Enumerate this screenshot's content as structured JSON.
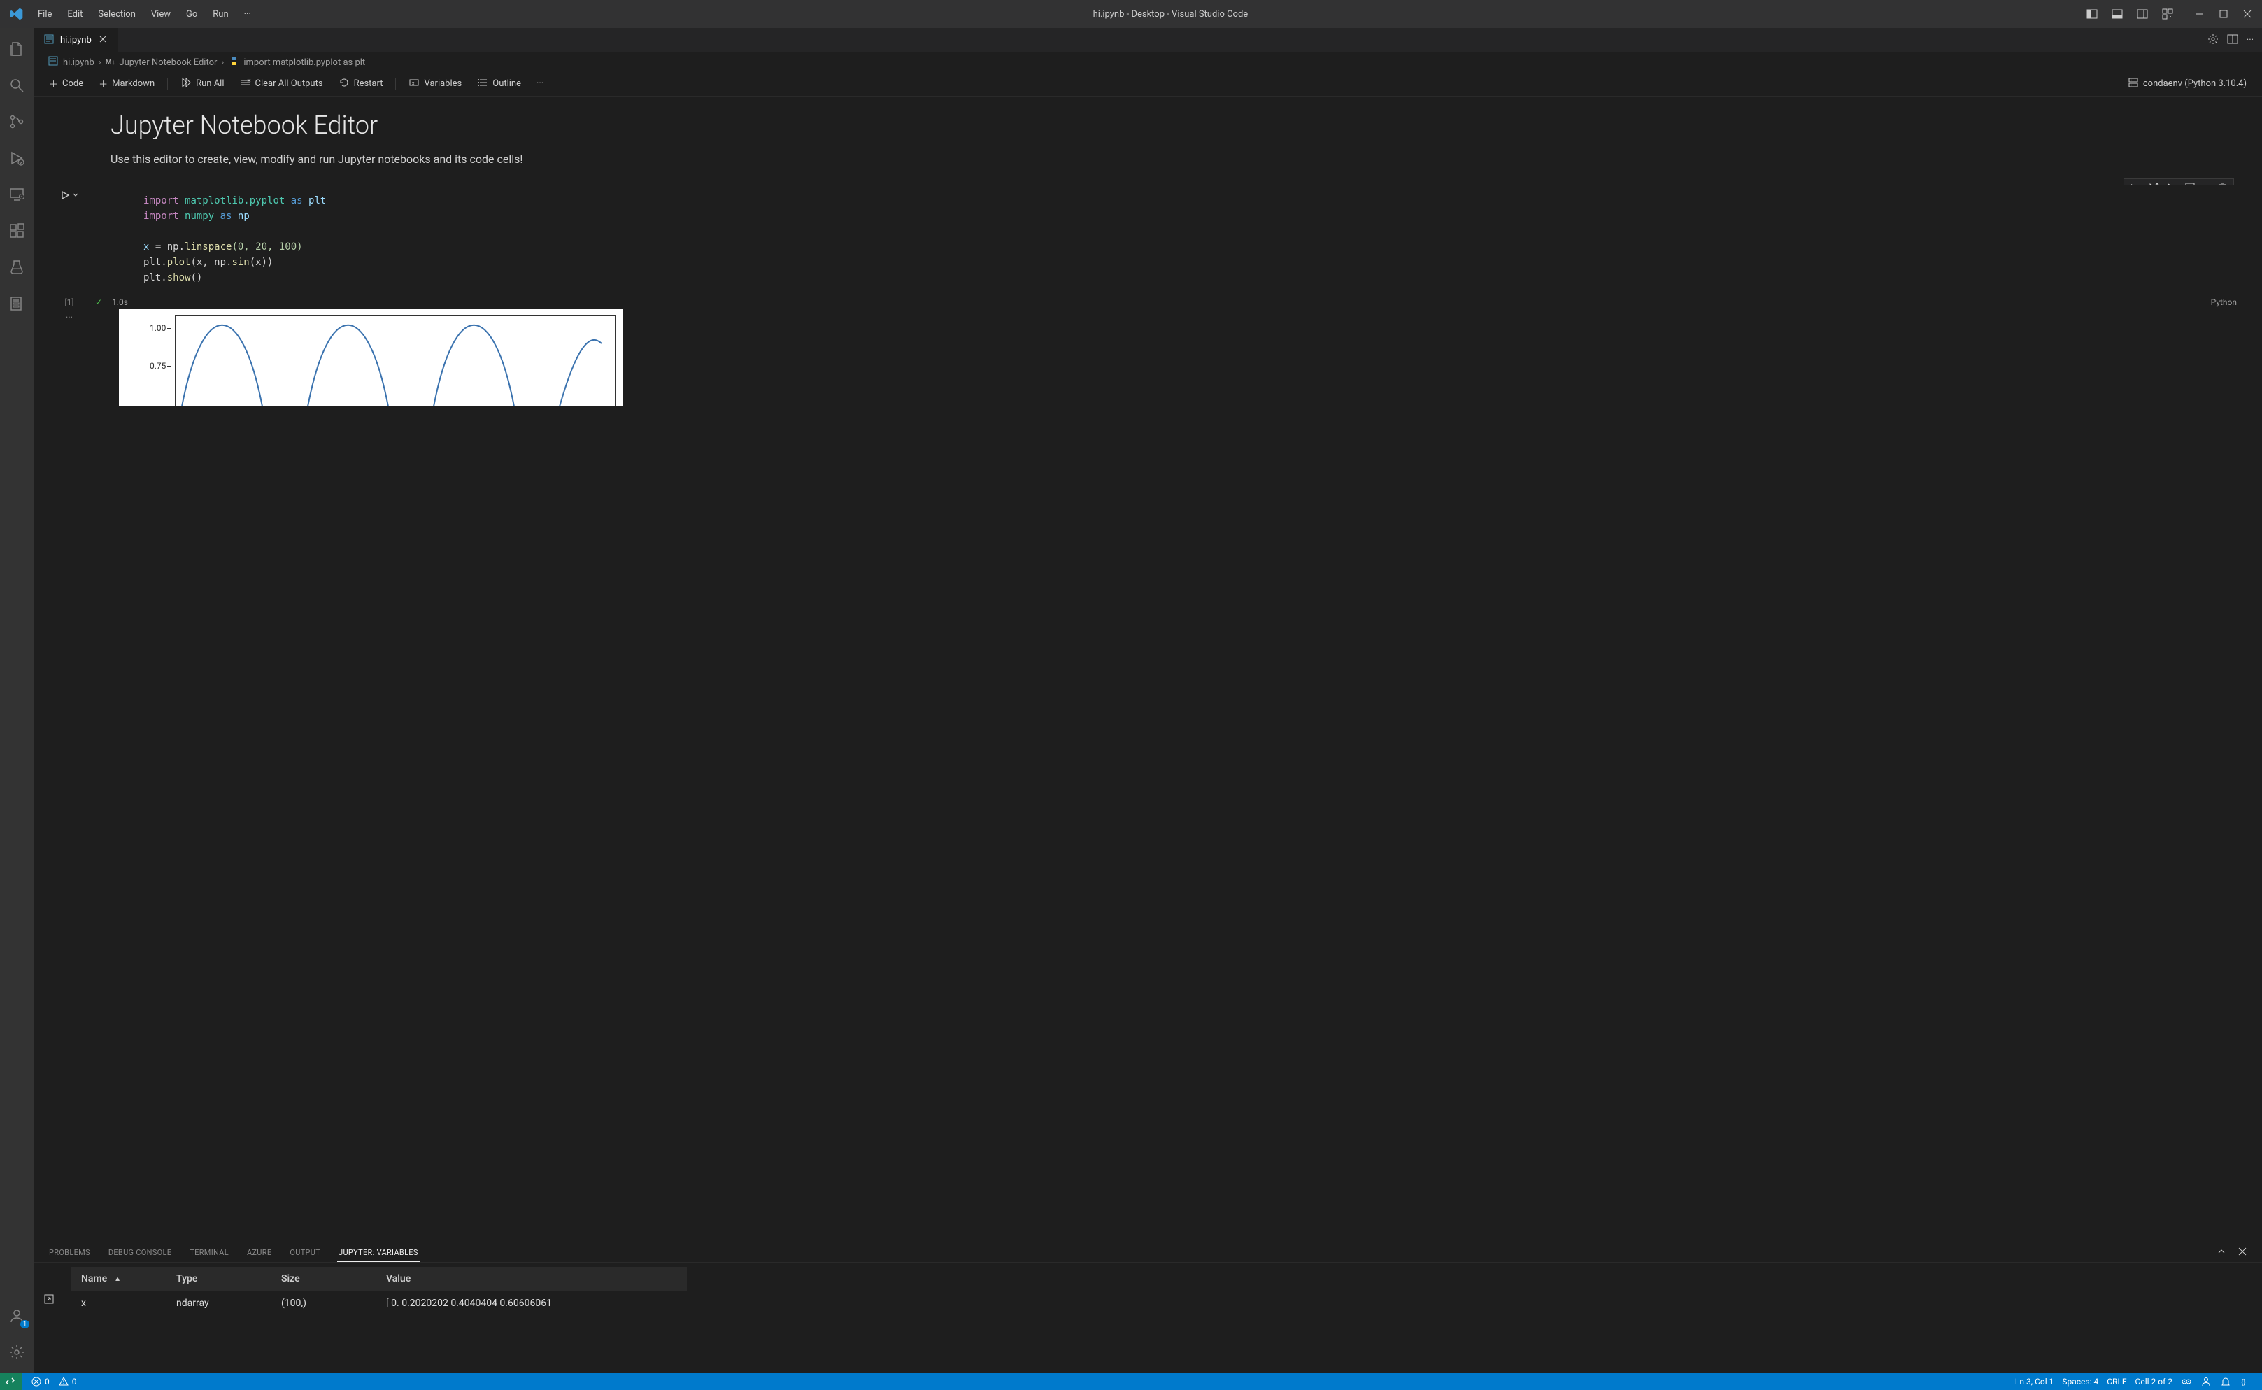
{
  "window": {
    "title": "hi.ipynb - Desktop - Visual Studio Code"
  },
  "menubar": [
    "File",
    "Edit",
    "Selection",
    "View",
    "Go",
    "Run",
    "···"
  ],
  "tab": {
    "label": "hi.ipynb"
  },
  "tab_actions": {
    "manage": "⚙"
  },
  "breadcrumbs": {
    "file": "hi.ipynb",
    "section_prefix": "M↓",
    "section": "Jupyter Notebook Editor",
    "cell": "import matplotlib.pyplot as plt"
  },
  "nb_toolbar": {
    "code": "Code",
    "markdown": "Markdown",
    "run_all": "Run All",
    "clear": "Clear All Outputs",
    "restart": "Restart",
    "variables": "Variables",
    "outline": "Outline",
    "kernel": "condaenv (Python 3.10.4)"
  },
  "notebook": {
    "title": "Jupyter Notebook Editor",
    "description": "Use this editor to create, view, modify and run Jupyter notebooks and its code cells!"
  },
  "cell": {
    "exec_count": "[1]",
    "time": "1.0s",
    "lang": "Python"
  },
  "code_lines": {
    "l1": {
      "kw": "import",
      "mod": "matplotlib.pyplot",
      "as": "as",
      "alias": "plt"
    },
    "l2": {
      "kw": "import",
      "mod": "numpy",
      "as": "as",
      "alias": "np"
    },
    "l4a": "x ",
    "l4b": "= np.",
    "l4fn": "linspace",
    "l4args": "(0, 20, 100)",
    "l5a": "plt.",
    "l5fn": "plot",
    "l5b": "(x, np.",
    "l5fn2": "sin",
    "l5c": "(x))",
    "l6a": "plt.",
    "l6fn": "show",
    "l6b": "()"
  },
  "panel": {
    "tabs": [
      "PROBLEMS",
      "DEBUG CONSOLE",
      "TERMINAL",
      "AZURE",
      "OUTPUT",
      "JUPYTER: VARIABLES"
    ],
    "active_index": 5,
    "cols": {
      "name": "Name",
      "type": "Type",
      "size": "Size",
      "value": "Value"
    },
    "row": {
      "name": "x",
      "type": "ndarray",
      "size": "(100,)",
      "value": "[ 0.          0.2020202   0.4040404   0.60606061"
    }
  },
  "statusbar": {
    "errors": "0",
    "warnings": "0",
    "lncol": "Ln 3, Col 1",
    "spaces": "Spaces: 4",
    "eol": "CRLF",
    "cell": "Cell 2 of 2"
  },
  "chart_data": {
    "type": "line",
    "title": "",
    "xlabel": "",
    "ylabel": "",
    "xlim": [
      0,
      20
    ],
    "ylim": [
      -1.0,
      1.0
    ],
    "visible_y_ticks": [
      1.0,
      0.75
    ],
    "series": [
      {
        "name": "sin(x)",
        "expression": "sin(x)",
        "x_sample_count": 100
      }
    ],
    "note": "Only top portion of the matplotlib sine plot is visible in the viewport"
  }
}
